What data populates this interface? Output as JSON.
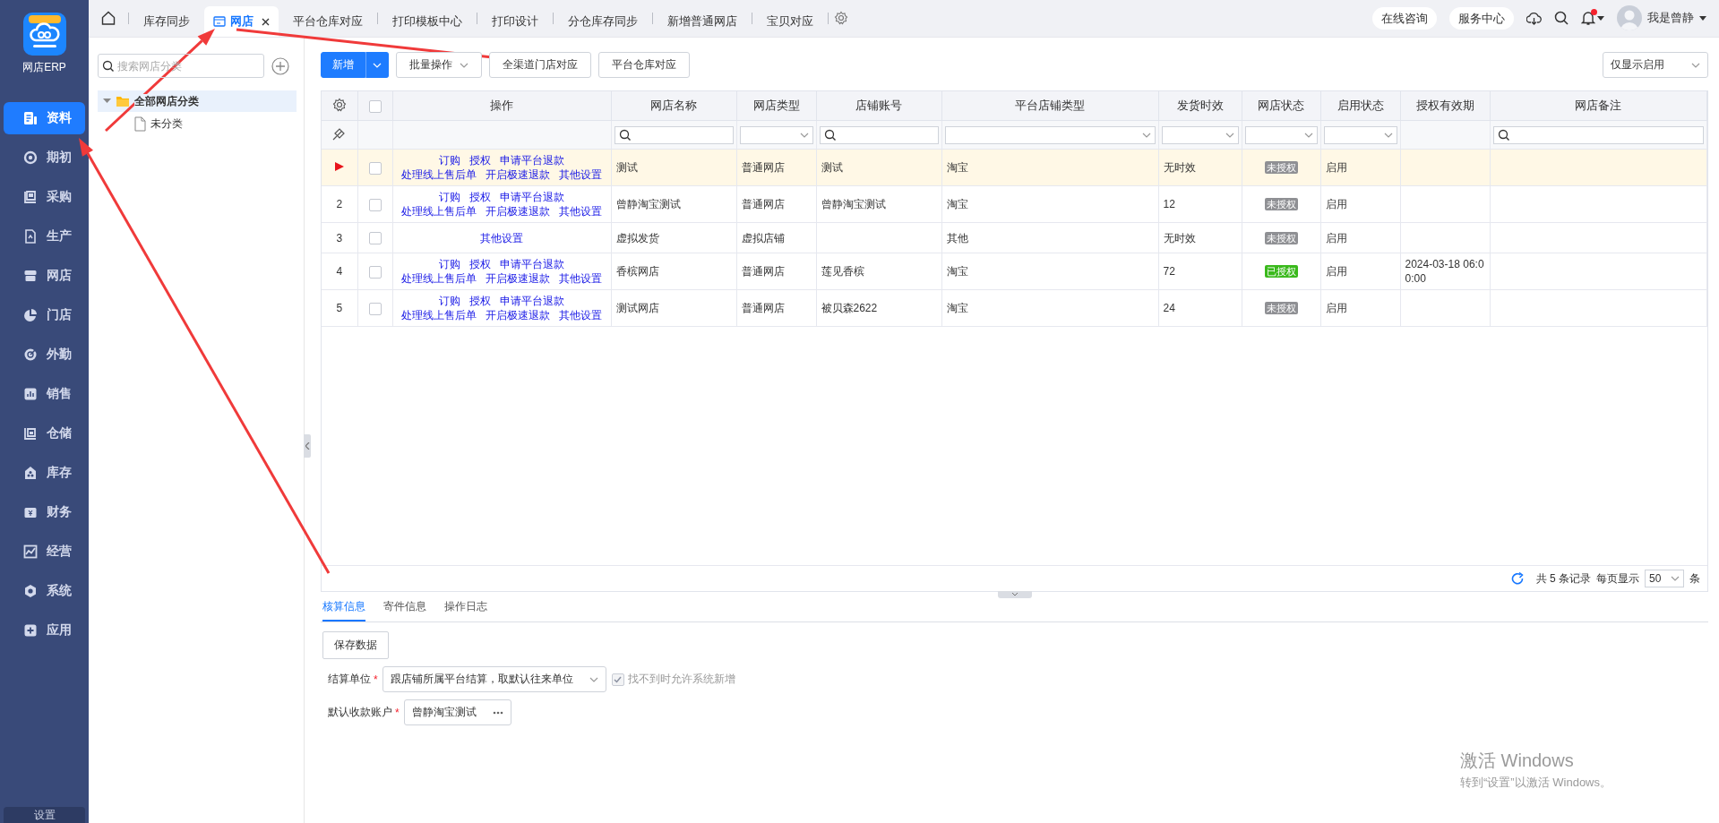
{
  "app": {
    "name": "网店ERP"
  },
  "sidebar": {
    "items": [
      {
        "label": "资料",
        "selected": true
      },
      {
        "label": "期初",
        "selected": false
      },
      {
        "label": "采购",
        "selected": false
      },
      {
        "label": "生产",
        "selected": false
      },
      {
        "label": "网店",
        "selected": false
      },
      {
        "label": "门店",
        "selected": false
      },
      {
        "label": "外勤",
        "selected": false
      },
      {
        "label": "销售",
        "selected": false
      },
      {
        "label": "仓储",
        "selected": false
      },
      {
        "label": "库存",
        "selected": false
      },
      {
        "label": "财务",
        "selected": false
      },
      {
        "label": "经营",
        "selected": false
      },
      {
        "label": "系统",
        "selected": false
      },
      {
        "label": "应用",
        "selected": false
      }
    ],
    "footer": "设置"
  },
  "tabs": [
    {
      "label": "库存同步",
      "selected": false,
      "closable": false
    },
    {
      "label": "网店",
      "selected": true,
      "closable": true
    },
    {
      "label": "平台仓库对应",
      "selected": false,
      "closable": false
    },
    {
      "label": "打印模板中心",
      "selected": false,
      "closable": false
    },
    {
      "label": "打印设计",
      "selected": false,
      "closable": false
    },
    {
      "label": "分仓库存同步",
      "selected": false,
      "closable": false
    },
    {
      "label": "新增普通网店",
      "selected": false,
      "closable": false
    },
    {
      "label": "宝贝对应",
      "selected": false,
      "closable": false
    }
  ],
  "header": {
    "links": [
      "在线咨询",
      "服务中心"
    ],
    "notifications": {
      "unread": true
    },
    "user": {
      "name": "我是曾静"
    }
  },
  "tree": {
    "search_placeholder": "搜索网店分类",
    "nodes": [
      {
        "label": "全部网店分类",
        "expanded": true,
        "selected": true,
        "children": [
          {
            "label": "未分类",
            "selected": false
          }
        ]
      }
    ]
  },
  "toolbar": {
    "buttons": [
      {
        "label": "新增",
        "kind": "split"
      },
      {
        "label": "批量操作",
        "kind": "menu"
      },
      {
        "label": "全渠道门店对应",
        "kind": "plain"
      },
      {
        "label": "平台仓库对应",
        "kind": "plain"
      }
    ],
    "view_filter": "仅显示启用"
  },
  "table": {
    "all_checked": false,
    "columns": [
      {
        "label": "操作"
      },
      {
        "label": "网店名称"
      },
      {
        "label": "网店类型"
      },
      {
        "label": "店铺账号"
      },
      {
        "label": "平台店铺类型"
      },
      {
        "label": "发货时效"
      },
      {
        "label": "网店状态"
      },
      {
        "label": "启用状态"
      },
      {
        "label": "授权有效期"
      },
      {
        "label": "网店备注"
      }
    ],
    "filters": [
      {
        "kind": "none"
      },
      {
        "kind": "search"
      },
      {
        "kind": "select"
      },
      {
        "kind": "search"
      },
      {
        "kind": "select"
      },
      {
        "kind": "select"
      },
      {
        "kind": "select"
      },
      {
        "kind": "select"
      },
      {
        "kind": "none"
      },
      {
        "kind": "search"
      }
    ],
    "rows": [
      {
        "current": true,
        "checked": false,
        "actions": [
          [
            "订购",
            "授权",
            "申请平台退款"
          ],
          [
            "处理线上售后单",
            "开启极速退款",
            "其他设置"
          ]
        ],
        "name": "测试",
        "type": "普通网店",
        "account": "测试",
        "platform": "淘宝",
        "ship_time": "无时效",
        "status": {
          "label": "未授权",
          "authorized": false
        },
        "enabled": "启用"
      },
      {
        "current": false,
        "index": "2",
        "checked": false,
        "actions": [
          [
            "订购",
            "授权",
            "申请平台退款"
          ],
          [
            "处理线上售后单",
            "开启极速退款",
            "其他设置"
          ]
        ],
        "name": "曾静淘宝测试",
        "type": "普通网店",
        "account": "曾静淘宝测试",
        "platform": "淘宝",
        "ship_time": "12",
        "status": {
          "label": "未授权",
          "authorized": false
        },
        "enabled": "启用"
      },
      {
        "current": false,
        "index": "3",
        "checked": false,
        "actions": [
          [
            "其他设置"
          ]
        ],
        "name": "虚拟发货",
        "type": "虚拟店铺",
        "platform": "其他",
        "ship_time": "无时效",
        "status": {
          "label": "未授权",
          "authorized": false
        },
        "enabled": "启用"
      },
      {
        "current": false,
        "index": "4",
        "checked": false,
        "actions": [
          [
            "订购",
            "授权",
            "申请平台退款"
          ],
          [
            "处理线上售后单",
            "开启极速退款",
            "其他设置"
          ]
        ],
        "name": "香槟网店",
        "type": "普通网店",
        "account": "莲见香槟",
        "platform": "淘宝",
        "ship_time": "72",
        "status": {
          "label": "已授权",
          "authorized": true
        },
        "enabled": "启用",
        "auth_expiry": "2024-03-18 06:00:00"
      },
      {
        "current": false,
        "index": "5",
        "checked": false,
        "actions": [
          [
            "订购",
            "授权",
            "申请平台退款"
          ],
          [
            "处理线上售后单",
            "开启极速退款",
            "其他设置"
          ]
        ],
        "name": "测试网店",
        "type": "普通网店",
        "account": "被贝森2622",
        "platform": "淘宝",
        "ship_time": "24",
        "status": {
          "label": "未授权",
          "authorized": false
        },
        "enabled": "启用"
      }
    ]
  },
  "pagination": {
    "summary": "共 5 条记录",
    "per_page_label": "每页显示",
    "per_page": "50",
    "unit": "条"
  },
  "detail_tabs": [
    {
      "label": "核算信息",
      "selected": true
    },
    {
      "label": "寄件信息",
      "selected": false
    },
    {
      "label": "操作日志",
      "selected": false
    }
  ],
  "form": {
    "save_button": "保存数据",
    "fields": [
      {
        "label": "结算单位",
        "required_mark": "*",
        "kind": "select",
        "value": "跟店铺所属平台结算，取默认往来单位",
        "option": {
          "label": "找不到时允许系统新增",
          "checked": true,
          "disabled": true
        }
      },
      {
        "label": "默认收款账户",
        "required_mark": "*",
        "kind": "picker",
        "value": "曾静淘宝测试"
      }
    ]
  },
  "os_notice": {
    "title": "激活 Windows",
    "hint": "转到“设置”以激活 Windows。"
  }
}
